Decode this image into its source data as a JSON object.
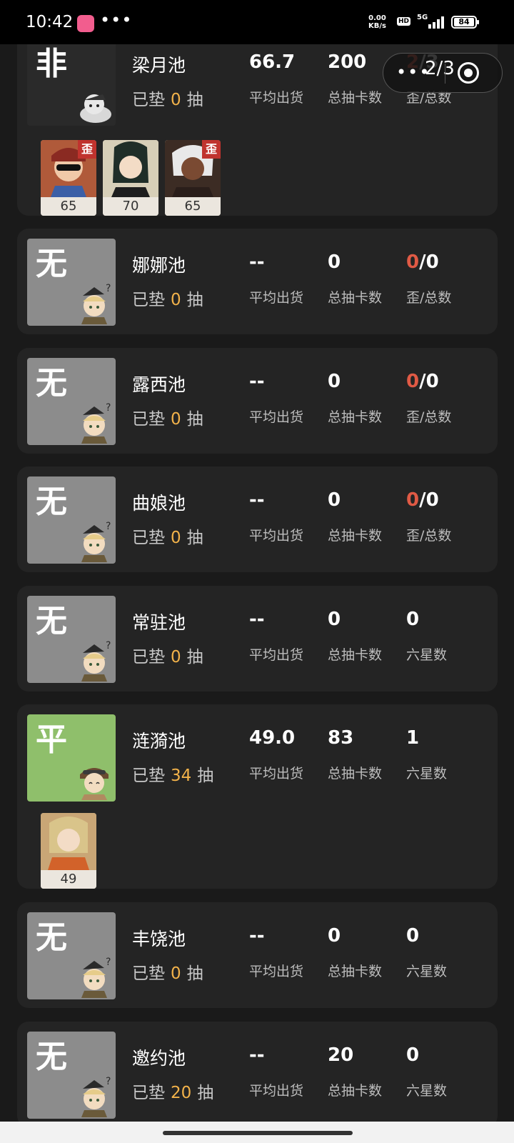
{
  "status_bar": {
    "time": "10:42",
    "dots": "•••",
    "net_speed_value": "0.00",
    "net_speed_unit": "KB/s",
    "hd": "HD",
    "signal": "5G",
    "battery": "84"
  },
  "floating_button": {
    "page": "2/3",
    "more_icon": "more-dots-icon",
    "target_icon": "target-icon"
  },
  "labels": {
    "avg": "平均出货",
    "total": "总抽卡数",
    "off_total": "歪/总数",
    "six_star": "六星数",
    "pity_prefix": "已垫",
    "pity_suffix": "抽",
    "off_tag": "歪"
  },
  "pools": [
    {
      "badge": "非",
      "name": "梁月池",
      "pity": "0",
      "avg": "66.7",
      "total": "200",
      "stat3_red": "2",
      "stat3_rest": "/3",
      "thumbs": [
        "65",
        "70",
        "65"
      ]
    },
    {
      "badge": "无",
      "name": "娜娜池",
      "pity": "0",
      "avg": "--",
      "total": "0",
      "stat3_red": "0",
      "stat3_rest": "/0"
    },
    {
      "badge": "无",
      "name": "露西池",
      "pity": "0",
      "avg": "--",
      "total": "0",
      "stat3_red": "0",
      "stat3_rest": "/0"
    },
    {
      "badge": "无",
      "name": "曲娘池",
      "pity": "0",
      "avg": "--",
      "total": "0",
      "stat3_red": "0",
      "stat3_rest": "/0"
    },
    {
      "badge": "无",
      "name": "常驻池",
      "pity": "0",
      "avg": "--",
      "total": "0",
      "stat3": "0"
    },
    {
      "badge": "平",
      "name": "涟漪池",
      "pity": "34",
      "avg": "49.0",
      "total": "83",
      "stat3": "1",
      "thumbs": [
        "49"
      ]
    },
    {
      "badge": "无",
      "name": "丰饶池",
      "pity": "0",
      "avg": "--",
      "total": "0",
      "stat3": "0"
    },
    {
      "badge": "无",
      "name": "邀约池",
      "pity": "20",
      "avg": "--",
      "total": "20",
      "stat3": "0"
    }
  ]
}
